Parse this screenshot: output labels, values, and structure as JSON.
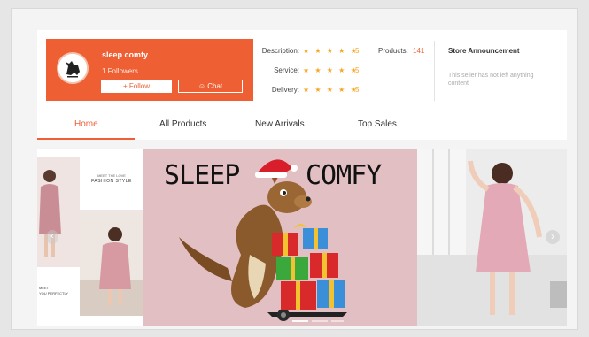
{
  "shop": {
    "name": "sleep comfy",
    "followers": "1 Followers",
    "follow_label": "+ Follow",
    "chat_label": "Chat",
    "logo_icon": "kangaroo-logo-icon"
  },
  "ratings": [
    {
      "label": "Description:",
      "score": "5"
    },
    {
      "label": "Service:",
      "score": "5"
    },
    {
      "label": "Delivery:",
      "score": "5"
    }
  ],
  "stars": "★ ★ ★ ★ ★",
  "products": {
    "label": "Products:",
    "value": "141"
  },
  "announcement": {
    "title": "Store Announcement",
    "text": "This seller has not left anything content"
  },
  "nav": {
    "tabs": [
      {
        "label": "Home",
        "active": true
      },
      {
        "label": "All Products",
        "active": false
      },
      {
        "label": "New Arrivals",
        "active": false
      },
      {
        "label": "Top Sales",
        "active": false
      }
    ]
  },
  "banner": {
    "headline_left": "SLEEP",
    "headline_right": "COMFY",
    "fashion_small": "MEET THE LOVE",
    "fashion_style": "FASHION STYLE",
    "meet_text": "MEET\nYOU PERFECTLY"
  },
  "colors": {
    "accent": "#ee5f33",
    "star": "#f5a623",
    "banner_pink": "#e2bfc2"
  }
}
